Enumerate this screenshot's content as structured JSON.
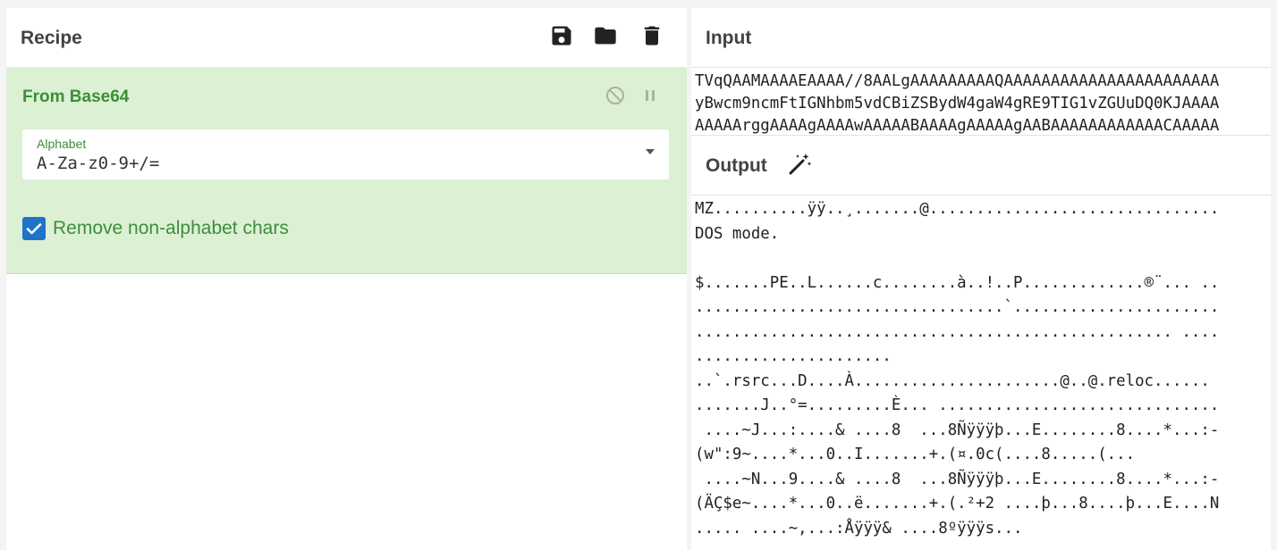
{
  "recipe": {
    "title": "Recipe",
    "toolbar": [
      "save-icon",
      "folder-icon",
      "trash-icon"
    ],
    "operation": {
      "name": "From Base64",
      "alphabet_label": "Alphabet",
      "alphabet_value": "A-Za-z0-9+/=",
      "remove_label": "Remove non-alphabet chars",
      "remove_checked": true
    }
  },
  "input": {
    "title": "Input",
    "lines": [
      "TVqQAAMAAAAEAAAA//8AALgAAAAAAAAAQAAAAAAAAAAAAAAAAAAAAAAA",
      "yBwcm9ncmFtIGNhbm5vdCBiZSBydW4gaW4gRE9TIG1vZGUuDQ0KJAAAA",
      "AAAAArggAAAAgAAAAwAAAAABAAAAgAAAAAgAABAAAAAAAAAAAACAAAAA"
    ]
  },
  "output": {
    "title": "Output",
    "lines": [
      "MZ..........ÿÿ..¸.......@...............................",
      "DOS mode.",
      "",
      "$.......PE..L......c........à..!..P.............®¨... ..",
      ".................................`......................",
      "................................................... ....",
      ".....................",
      "..`.rsrc...D....À......................@..@.reloc......",
      ".......J..°=.........È... ..............................",
      " ....~J...:....& ....8  ...8Ñÿÿÿþ...E........8....*...:-",
      "(w\":9~....*...0..I.......+.(¤.0c(....8.....(...",
      " ....~N...9....& ....8  ...8Ñÿÿÿþ...E........8....*...:-",
      "(ÄÇ$e~....*...0..ë.......+.(.²+2 ....þ...8....þ...E....N",
      "..... ....~,...:Åÿÿÿ& ....8ºÿÿÿs..."
    ]
  }
}
